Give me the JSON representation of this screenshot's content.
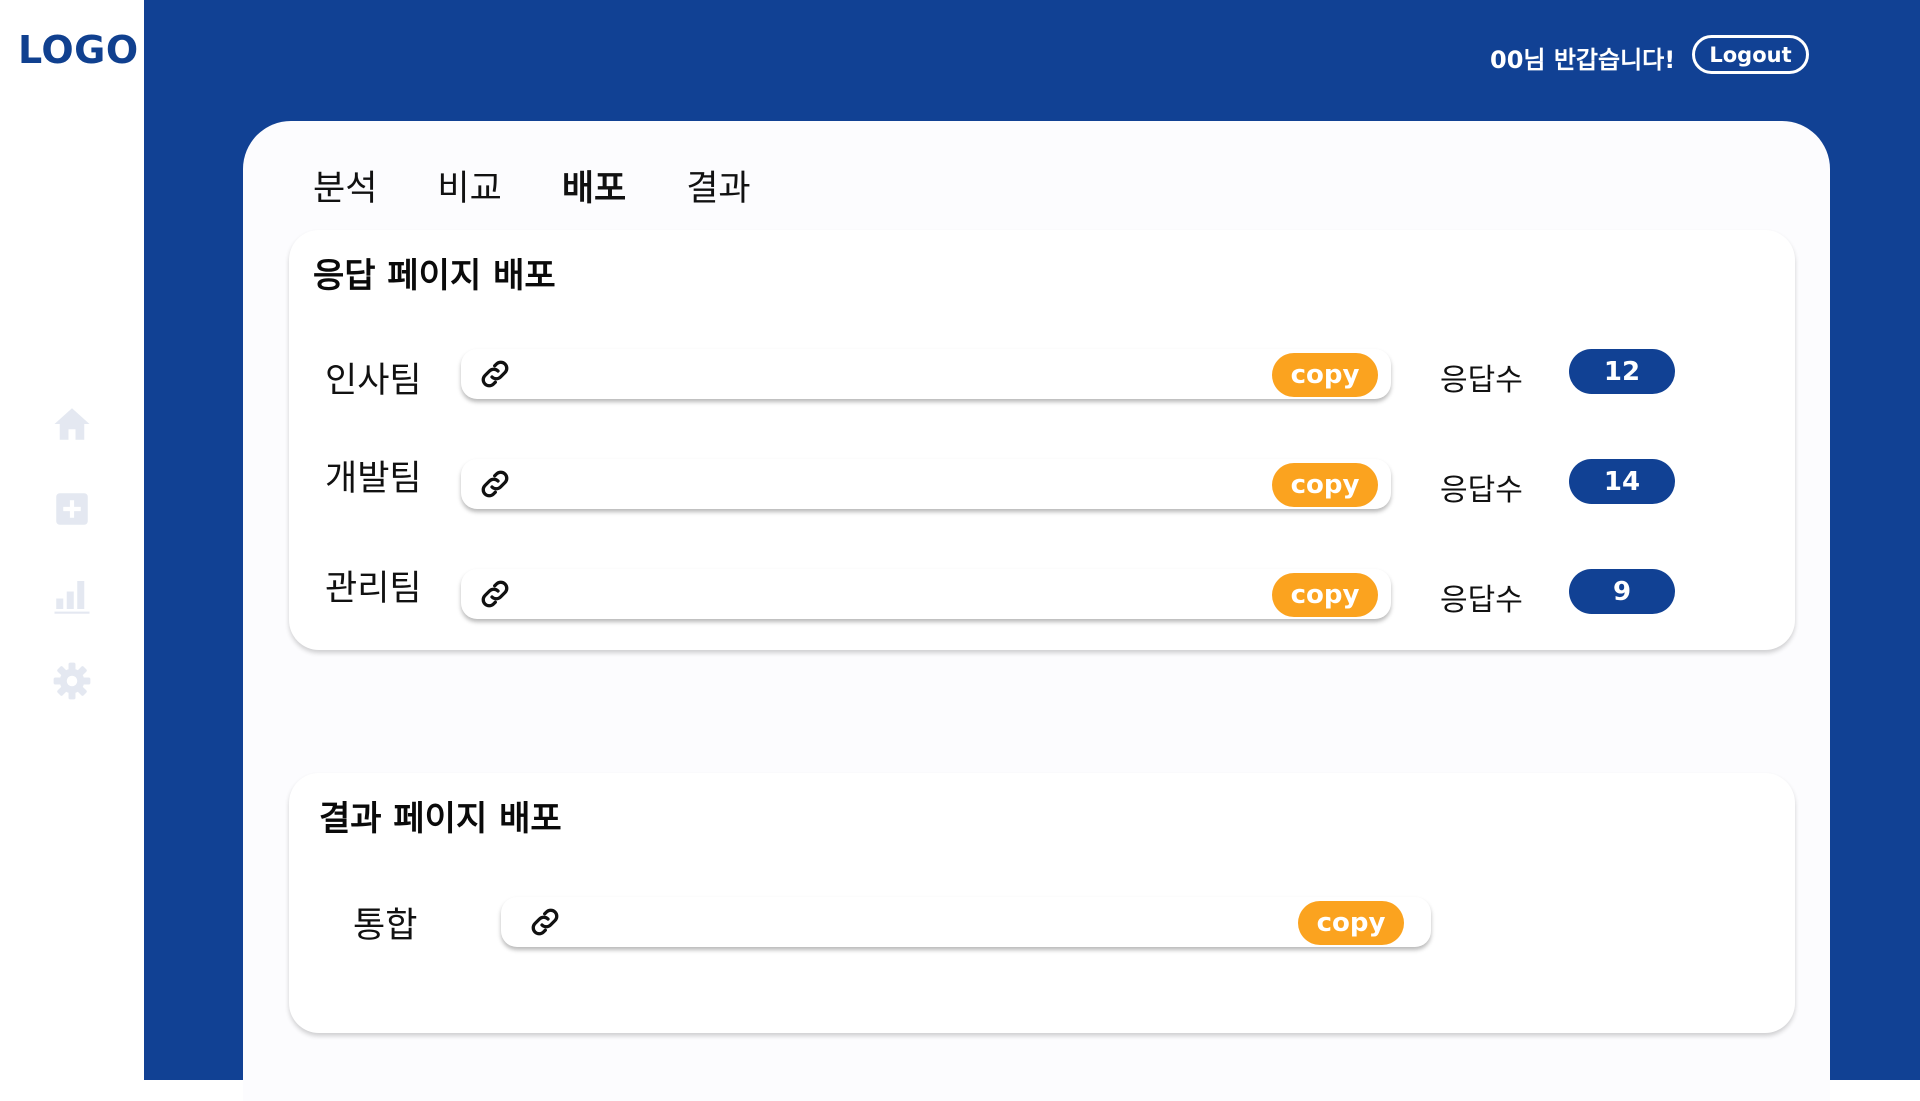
{
  "logo": "LOGO",
  "header": {
    "greeting": "00님 반갑습니다!",
    "logout_label": "Logout"
  },
  "sidebar": {
    "icons": [
      "home-icon",
      "add-square-icon",
      "chart-icon",
      "gear-icon"
    ]
  },
  "tabs": [
    {
      "label": "분석",
      "active": false
    },
    {
      "label": "비교",
      "active": false
    },
    {
      "label": "배포",
      "active": true
    },
    {
      "label": "결과",
      "active": false
    }
  ],
  "response_section": {
    "title": "응답 페이지 배포",
    "rows": [
      {
        "team": "인사팀",
        "copy_label": "copy",
        "count_label": "응답수",
        "count": "12"
      },
      {
        "team": "개발팀",
        "copy_label": "copy",
        "count_label": "응답수",
        "count": "14"
      },
      {
        "team": "관리팀",
        "copy_label": "copy",
        "count_label": "응답수",
        "count": "9"
      }
    ]
  },
  "result_section": {
    "title": "결과 페이지 배포",
    "rows": [
      {
        "team": "통합",
        "copy_label": "copy"
      }
    ]
  },
  "colors": {
    "primary": "#114194",
    "accent": "#fba31f",
    "sidebar_icon": "#e4e8f1"
  }
}
